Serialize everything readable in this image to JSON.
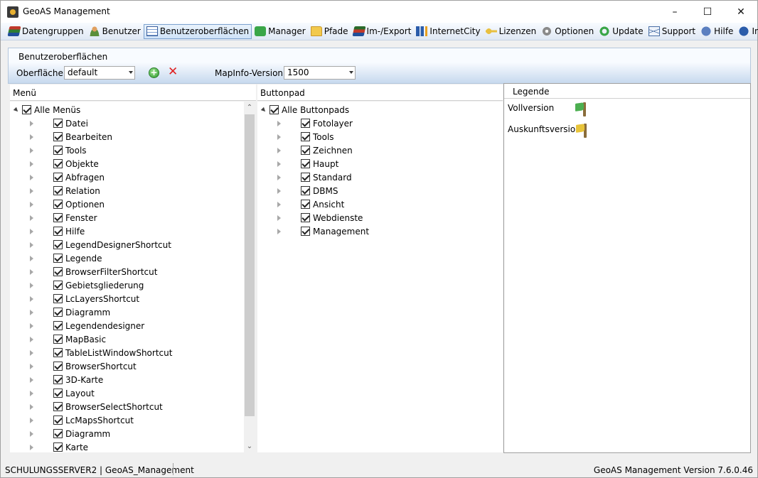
{
  "window": {
    "title": "GeoAS Management"
  },
  "menu": [
    {
      "label": "Datengruppen",
      "icon": "books-icon",
      "active": false
    },
    {
      "label": "Benutzer",
      "icon": "user-icon",
      "active": false
    },
    {
      "label": "Benutzeroberflächen",
      "icon": "form-icon",
      "active": true
    },
    {
      "label": "Manager",
      "icon": "puzzle-icon",
      "active": false
    },
    {
      "label": "Pfade",
      "icon": "folder-icon",
      "active": false
    },
    {
      "label": "Im-/Export",
      "icon": "export-icon",
      "active": false
    },
    {
      "label": "InternetCity",
      "icon": "city-icon",
      "active": false
    },
    {
      "label": "Lizenzen",
      "icon": "key-icon",
      "active": false
    },
    {
      "label": "Optionen",
      "icon": "gear-icon",
      "active": false
    },
    {
      "label": "Update",
      "icon": "update-icon",
      "active": false
    },
    {
      "label": "Support",
      "icon": "mail-icon",
      "active": false
    },
    {
      "label": "Hilfe",
      "icon": "help-icon",
      "active": false
    },
    {
      "label": "Info",
      "icon": "info-icon",
      "active": false
    }
  ],
  "panel": {
    "title": "Benutzeroberflächen",
    "surface_label": "Oberfläche:",
    "surface_value": "default",
    "mapinfo_label": "MapInfo-Version:",
    "mapinfo_value": "1500"
  },
  "menu_tree": {
    "header": "Menü",
    "root": "Alle Menüs",
    "items": [
      "Datei",
      "Bearbeiten",
      "Tools",
      "Objekte",
      "Abfragen",
      "Relation",
      "Optionen",
      "Fenster",
      "Hilfe",
      "LegendDesignerShortcut",
      "Legende",
      "BrowserFilterShortcut",
      "Gebietsgliederung",
      "LcLayersShortcut",
      "Diagramm",
      "Legendendesigner",
      "MapBasic",
      "TableListWindowShortcut",
      "BrowserShortcut",
      "3D-Karte",
      "Layout",
      "BrowserSelectShortcut",
      "LcMapsShortcut",
      "Diagramm",
      "Karte"
    ]
  },
  "buttonpad_tree": {
    "header": "Buttonpad",
    "root": "Alle Buttonpads",
    "items": [
      "Fotolayer",
      "Tools",
      "Zeichnen",
      "Haupt",
      "Standard",
      "DBMS",
      "Ansicht",
      "Webdienste",
      "Management"
    ]
  },
  "legend": {
    "header": "Legende",
    "entries": [
      {
        "label": "Vollversion",
        "color": "#4caf50"
      },
      {
        "label": "Auskunftsversion",
        "color": "#e8c43a"
      }
    ]
  },
  "status": {
    "left": "SCHULUNGSSERVER2 | GeoAS_Management",
    "right": "GeoAS Management Version 7.6.0.46"
  }
}
